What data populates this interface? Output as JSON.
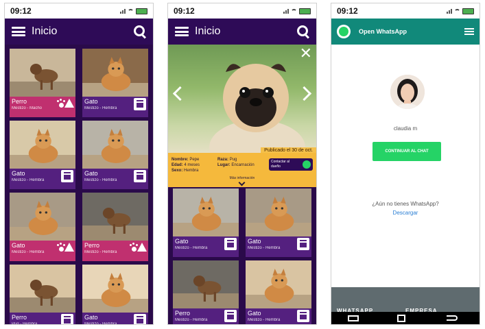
{
  "status": {
    "time": "09:12"
  },
  "home": {
    "title": "Inicio"
  },
  "cards_left": [
    {
      "type": "Perro",
      "desc": "Mestizo - Macho",
      "variant": "pink",
      "icon": "paw-alert"
    },
    {
      "type": "Gato",
      "desc": "Mestizo - Hembra",
      "variant": "purple",
      "icon": "adopt"
    },
    {
      "type": "Gato",
      "desc": "Mestizo - Hembra",
      "variant": "pink",
      "icon": "paw-alert"
    },
    {
      "type": "Perro",
      "desc": "Pug - Hembra",
      "variant": "purple",
      "icon": "adopt"
    }
  ],
  "cards_right": [
    {
      "type": "Gato",
      "desc": "Mestizo - Hembra",
      "variant": "purple",
      "icon": "adopt"
    },
    {
      "type": "Gato",
      "desc": "Mestizo - Hembra",
      "variant": "purple",
      "icon": "adopt"
    },
    {
      "type": "Perro",
      "desc": "Mestizo - Hembra",
      "variant": "pink",
      "icon": "paw-alert"
    },
    {
      "type": "Gato",
      "desc": "Mestizo - Hembra",
      "variant": "purple",
      "icon": "adopt"
    }
  ],
  "detail": {
    "published": "Publicado el 30 de oct.",
    "nombre_label": "Nombre:",
    "nombre": "Pepe",
    "edad_label": "Edad:",
    "edad": "4 meses",
    "sexo_label": "Sexo:",
    "sexo": "Hembra",
    "raza_label": "Raza:",
    "raza": "Pug",
    "lugar_label": "Lugar:",
    "lugar": "Encarnación",
    "contact": "Contactar al dueño",
    "more": "Más información"
  },
  "detail_cards": [
    {
      "type": "Gato",
      "desc": "Mestizo - Hembra"
    },
    {
      "type": "Gato",
      "desc": "Mestizo - Hembra"
    },
    {
      "type": "Perro",
      "desc": "Mestizo - Hembra"
    },
    {
      "type": "Gato",
      "desc": "Mestizo - Hembra"
    }
  ],
  "whatsapp": {
    "title": "Open WhatsApp",
    "user": "claudia m",
    "button": "CONTINUAR AL CHAT",
    "question": "¿Aún no tienes WhatsApp?",
    "download": "Descargar",
    "footer_left": "WHATSAPP",
    "footer_right": "EMPRESA"
  },
  "colors": {
    "brand_purple": "#2e0b57",
    "pink": "#c0306f",
    "amber": "#f5b93c",
    "whatsapp_green": "#25d366",
    "whatsapp_teal": "#11897a"
  }
}
